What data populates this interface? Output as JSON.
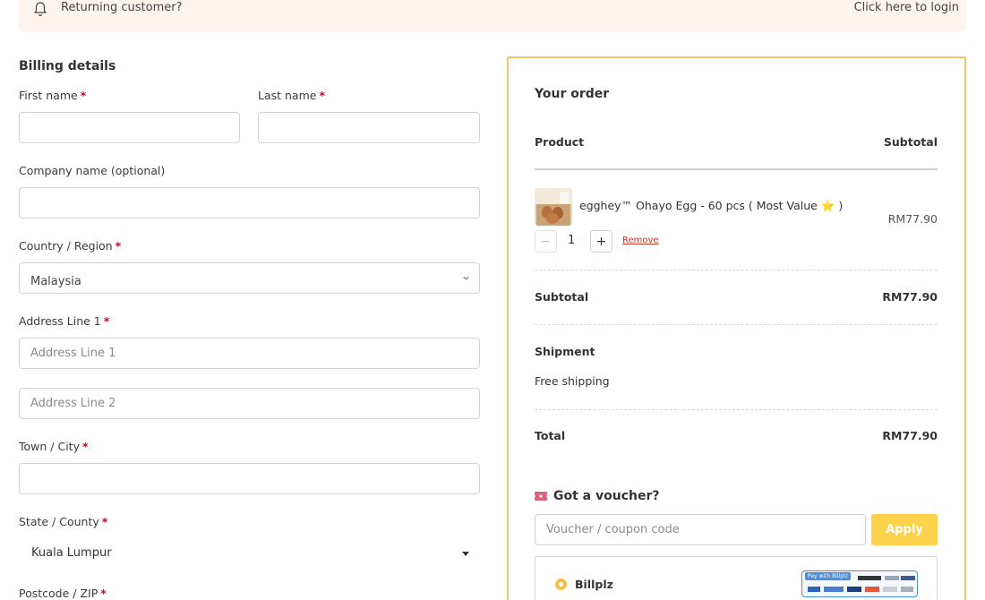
{
  "notice": {
    "text": "Returning customer?",
    "login_link": "Click here to login"
  },
  "billing": {
    "title": "Billing details",
    "first_name_label": "First name",
    "last_name_label": "Last name",
    "company_label": "Company name (optional)",
    "country_label": "Country / Region",
    "country_value": "Malaysia",
    "address1_label": "Address Line 1",
    "address1_placeholder": "Address Line 1",
    "address2_placeholder": "Address Line 2",
    "city_label": "Town / City",
    "state_label": "State / County",
    "state_value": "Kuala Lumpur",
    "postcode_label": "Postcode / ZIP",
    "required_mark": "*"
  },
  "order": {
    "title": "Your order",
    "col_product": "Product",
    "col_subtotal": "Subtotal",
    "item": {
      "name": "egghey™ Ohayo Egg - 60 pcs ( Most Value ⭐ )",
      "price": "RM77.90",
      "quantity": "1",
      "minus": "−",
      "plus": "+",
      "remove": "Remove"
    },
    "subtotal_label": "Subtotal",
    "subtotal_value": "RM77.90",
    "shipment_label": "Shipment",
    "shipment_value": "Free shipping",
    "total_label": "Total",
    "total_value": "RM77.90"
  },
  "voucher": {
    "title": "Got a voucher?",
    "placeholder": "Voucher / coupon code",
    "apply": "Apply"
  },
  "payment": {
    "method_name": "Billplz",
    "logo_text": "Pay with Billplz"
  },
  "colors": {
    "accent": "#fcd24a",
    "order_border": "#f3c46a",
    "required": "#d0021b",
    "remove": "#c0392b",
    "notice_bg": "#fdf4ee"
  }
}
